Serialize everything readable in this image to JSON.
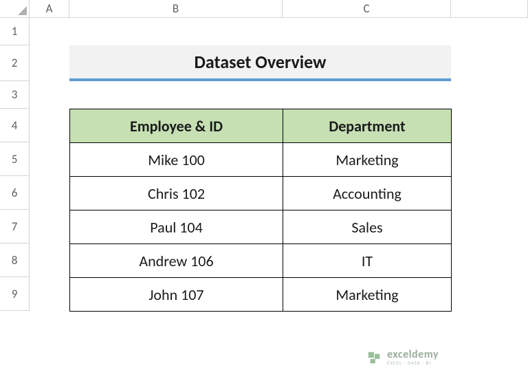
{
  "columns": [
    "A",
    "B",
    "C"
  ],
  "rows": [
    "1",
    "2",
    "3",
    "4",
    "5",
    "6",
    "7",
    "8",
    "9"
  ],
  "title": "Dataset Overview",
  "table": {
    "headers": [
      "Employee & ID",
      "Department"
    ],
    "data": [
      [
        "Mike 100",
        "Marketing"
      ],
      [
        "Chris 102",
        "Accounting"
      ],
      [
        "Paul 104",
        "Sales"
      ],
      [
        "Andrew 106",
        "IT"
      ],
      [
        "John 107",
        "Marketing"
      ]
    ]
  },
  "watermark": {
    "brand": "exceldemy",
    "tagline": "EXCEL · DATA · BI"
  }
}
